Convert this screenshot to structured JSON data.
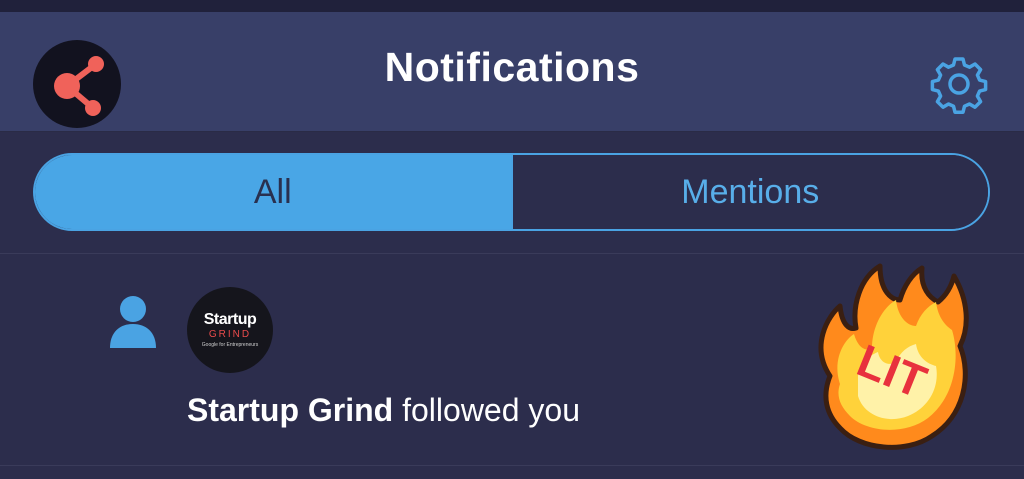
{
  "header": {
    "title": "Notifications",
    "logo_icon": "share-network-icon",
    "settings_icon": "gear-icon",
    "background": "#383f68",
    "logo_accent": "#f0625a"
  },
  "tabs": [
    {
      "label": "All",
      "selected": true
    },
    {
      "label": "Mentions",
      "selected": false
    }
  ],
  "accent": "#49a6e6",
  "notifications": [
    {
      "type_icon": "person-icon",
      "avatar": {
        "line1": "Startup",
        "line2": "GRIND",
        "line3": "Google for Entrepreneurs"
      },
      "actor": "Startup Grind",
      "action": " followed you",
      "sticker": {
        "text": "LIT",
        "icon": "fire-icon"
      }
    }
  ]
}
